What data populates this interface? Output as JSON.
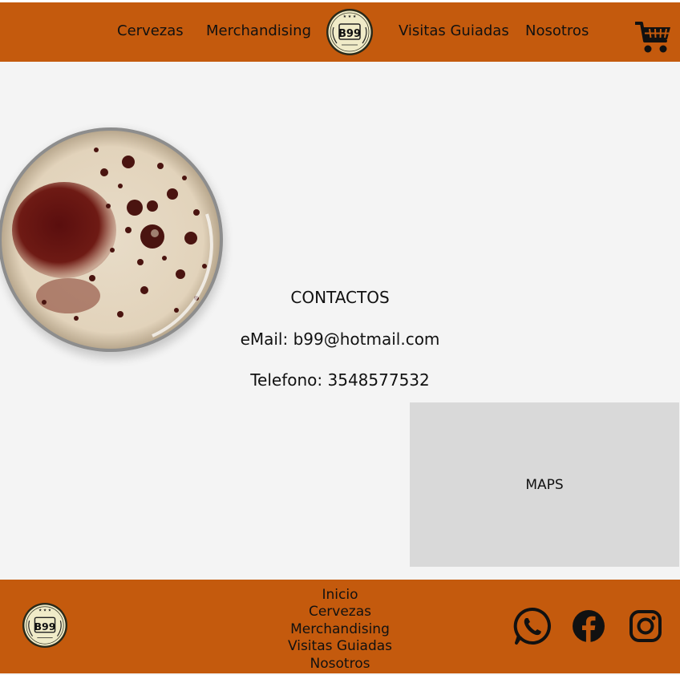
{
  "nav": {
    "links": [
      "Cervezas",
      "Merchandising",
      "Visitas Guiadas",
      "Nosotros"
    ],
    "logo_text": "B99",
    "cart_icon": "shopping-cart-icon"
  },
  "contact": {
    "title": "CONTACTOS",
    "email": "eMail: b99@hotmail.com",
    "phone": "Telefono: 3548577532"
  },
  "maps": {
    "label": "MAPS"
  },
  "footer": {
    "logo_text": "B99",
    "links": [
      "Inicio",
      "Cervezas",
      "Merchandising",
      "Visitas Guiadas",
      "Nosotros"
    ],
    "social_icons": [
      "whatsapp-icon",
      "facebook-icon",
      "instagram-icon"
    ]
  },
  "colors": {
    "brand": "#c45a0d",
    "background": "#f4f4f4",
    "maps_placeholder": "#d9d9d9"
  }
}
